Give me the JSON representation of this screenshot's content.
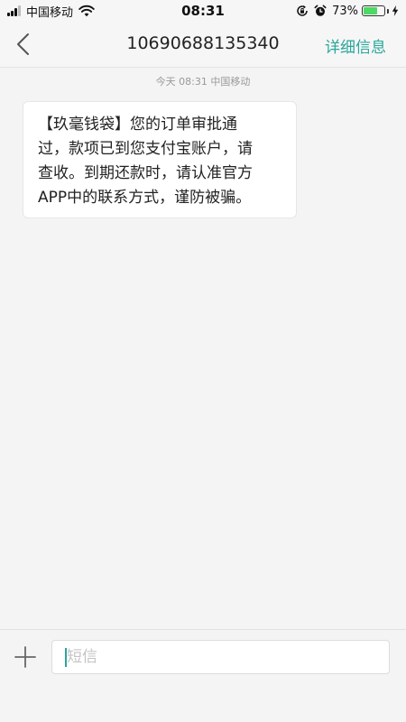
{
  "status_bar": {
    "carrier": "中国移动",
    "time": "08:31",
    "battery_percent": "73%",
    "battery_level": 0.73,
    "icons": [
      "signal-icon",
      "wifi-icon",
      "rotation-lock-icon",
      "alarm-icon",
      "battery-icon",
      "charging-bolt-icon"
    ]
  },
  "nav": {
    "title": "10690688135340",
    "detail_label": "详细信息",
    "back_icon": "chevron-left-icon"
  },
  "conversation": {
    "timestamp": "今天  08:31  中国移动",
    "message_lines": [
      "【玖毫钱袋】您的订单审批通",
      "过，款项已到您支付宝账户，请",
      "查收。到期还款时，请认准官方",
      "APP中的联系方式，谨防被骗。"
    ]
  },
  "composer": {
    "placeholder": "短信",
    "value": "",
    "add_icon": "plus-icon"
  },
  "colors": {
    "accent": "#2aa69b",
    "battery": "#4cd964",
    "background": "#f4f4f4"
  }
}
